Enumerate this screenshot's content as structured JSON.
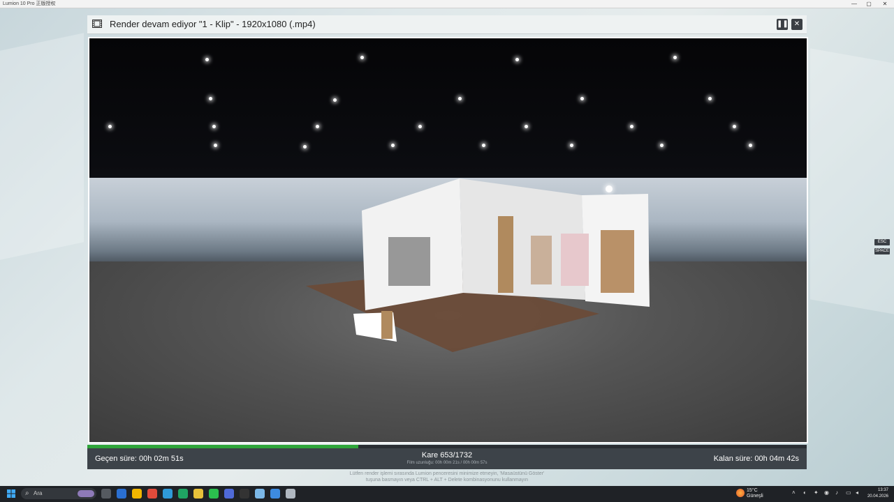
{
  "os": {
    "window_title": "Lumion 10 Pro 正版授权",
    "minimize": "—",
    "maximize": "▢",
    "close": "✕"
  },
  "dialog": {
    "title": "Render devam ediyor \"1 - Klip\" - 1920x1080 (.mp4)",
    "pause_label": "❚❚",
    "close_label": "✕"
  },
  "shortcuts": {
    "esc": "ESC",
    "space": "SPACE"
  },
  "progress": {
    "fraction": 0.377,
    "frame": "Kare 653/1732",
    "film_length": "Film uzunluğu: 00h 00m 21s / 00h 00m 57s",
    "elapsed": "Geçen süre: 00h 02m 51s",
    "remaining": "Kalan süre: 00h 04m 42s"
  },
  "hint": {
    "line1": "Lütfen render işlemi sırasında Lumion penceresini minimize etmeyin, 'Masaüstünü Göster'",
    "line2": "tuşuna basmayın veya CTRL + ALT + Delete kombinasyonunu kullanmayın"
  },
  "taskbar": {
    "search_text": "Ara",
    "weather_temp": "15°C",
    "weather_desc": "Güneşli",
    "time": "13:37",
    "date": "20.04.2026",
    "apps": [
      "#555a60",
      "#2a6fd1",
      "#f2b600",
      "#e14b3b",
      "#2f9ad8",
      "#1fa463",
      "#e8c23a",
      "#2bbf4e",
      "#4f6ad8",
      "#333",
      "#7bb8e8",
      "#3d8be0",
      "#b0b8c0"
    ]
  },
  "colors": {
    "progress": "#2fa53a"
  }
}
